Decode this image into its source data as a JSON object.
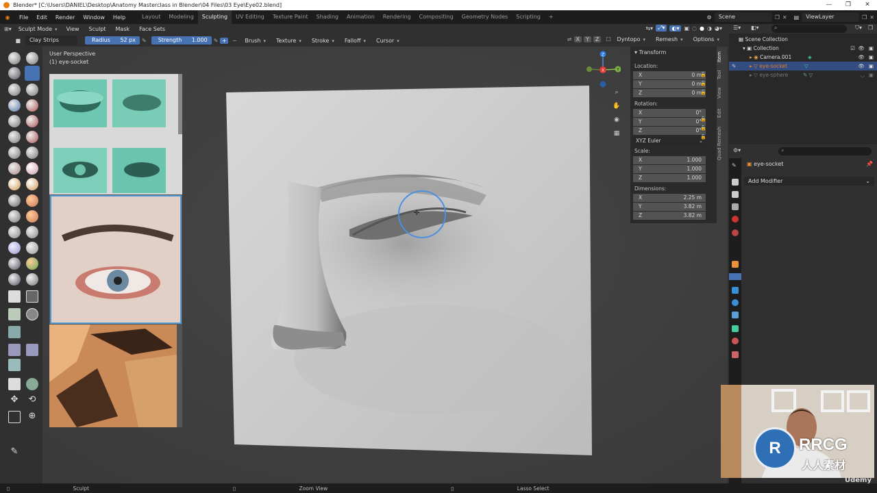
{
  "window": {
    "title": "Blender* [C:\\Users\\DANIEL\\Desktop\\Anatomy Masterclass in Blender\\04 Files\\03 Eye\\Eye02.blend]",
    "controls": [
      "—",
      "❐",
      "✕"
    ]
  },
  "menubar": {
    "menus": [
      "File",
      "Edit",
      "Render",
      "Window",
      "Help"
    ],
    "workspaces": [
      "Layout",
      "Modeling",
      "Sculpting",
      "UV Editing",
      "Texture Paint",
      "Shading",
      "Animation",
      "Rendering",
      "Compositing",
      "Geometry Nodes",
      "Scripting"
    ],
    "active_workspace": "Sculpting",
    "add_workspace": "+",
    "scene": "Scene",
    "view_layer": "ViewLayer"
  },
  "viewport_header": {
    "mode": "Sculpt Mode",
    "menus": [
      "View",
      "Sculpt",
      "Mask",
      "Face Sets"
    ]
  },
  "tool_header": {
    "brush": "Clay Strips",
    "radius_label": "Radius",
    "radius_value": "52 px",
    "strength_label": "Strength",
    "strength_value": "1.000",
    "plus": "+",
    "minus": "−",
    "dropdowns": [
      "Brush",
      "Texture",
      "Stroke",
      "Falloff",
      "Cursor"
    ],
    "axes": [
      "X",
      "Y",
      "Z"
    ],
    "dyntopo": "Dyntopo",
    "remesh": "Remesh",
    "options": "Options"
  },
  "viewport": {
    "view_name": "User Perspective",
    "object_name": "(1) eye-socket",
    "gizmo_axes": [
      "X",
      "Y",
      "Z"
    ]
  },
  "npanel": {
    "section": "Transform",
    "location_label": "Location:",
    "location": [
      {
        "k": "X",
        "v": "0 m"
      },
      {
        "k": "Y",
        "v": "0 m"
      },
      {
        "k": "Z",
        "v": "0 m"
      }
    ],
    "rotation_label": "Rotation:",
    "rotation": [
      {
        "k": "X",
        "v": "0°"
      },
      {
        "k": "Y",
        "v": "0°"
      },
      {
        "k": "Z",
        "v": "0°"
      }
    ],
    "rotation_mode": "XYZ Euler",
    "scale_label": "Scale:",
    "scale": [
      {
        "k": "X",
        "v": "1.000"
      },
      {
        "k": "Y",
        "v": "1.000"
      },
      {
        "k": "Z",
        "v": "1.000"
      }
    ],
    "dimensions_label": "Dimensions:",
    "dimensions": [
      {
        "k": "X",
        "v": "2.25 m"
      },
      {
        "k": "Y",
        "v": "3.82 m"
      },
      {
        "k": "Z",
        "v": "3.82 m"
      }
    ],
    "tabs": [
      "Item",
      "Tool",
      "View",
      "Edit",
      "Quad Remesh"
    ]
  },
  "outliner": {
    "items": [
      {
        "label": "Scene Collection"
      },
      {
        "label": "Collection"
      },
      {
        "label": "Camera.001"
      },
      {
        "label": "eye-socket"
      },
      {
        "label": "eye-sphere"
      }
    ]
  },
  "properties": {
    "object": "eye-socket",
    "add_modifier": "Add Modifier"
  },
  "statusbar": {
    "items": [
      "Sculpt",
      "Zoom View",
      "Lasso Select"
    ]
  },
  "watermark": {
    "brand": "RRCG",
    "sub": "人人素材",
    "udemy": "Udemy"
  },
  "colors": {
    "accent": "#4772b3",
    "brush_ring": "#4a8fe0",
    "object_selected": "#e57b2d"
  }
}
